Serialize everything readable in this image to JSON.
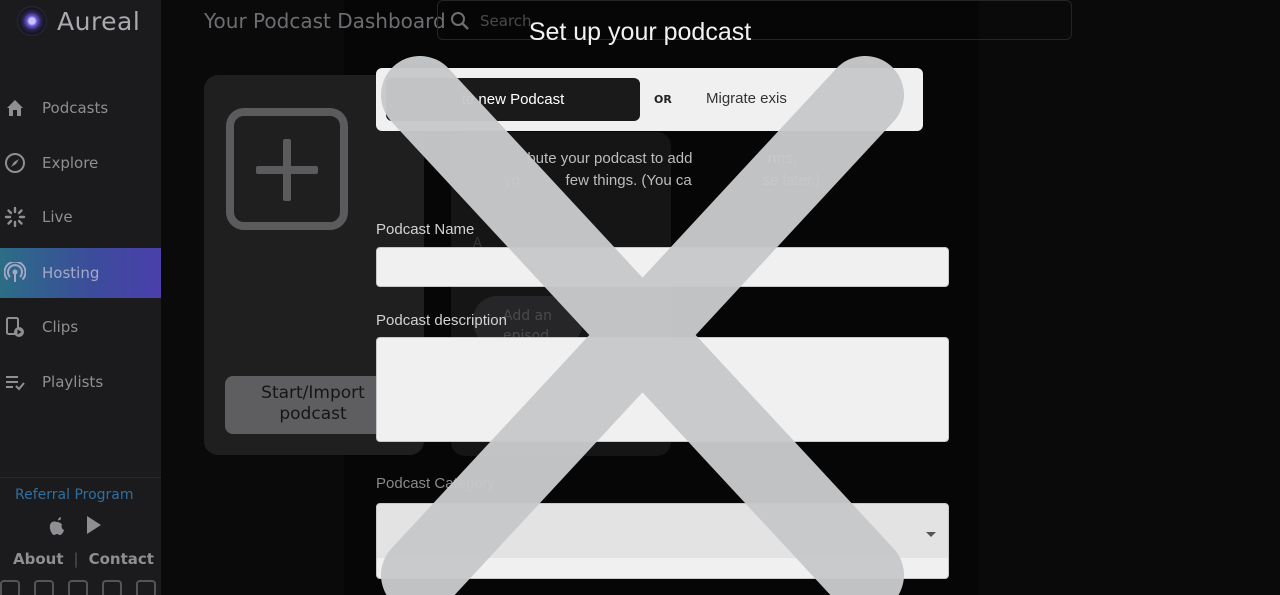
{
  "app": {
    "name": "Aureal"
  },
  "sidebar": {
    "items": [
      {
        "label": "Podcasts",
        "icon": "home-icon",
        "active": false
      },
      {
        "label": "Explore",
        "icon": "compass-icon",
        "active": false
      },
      {
        "label": "Live",
        "icon": "live-icon",
        "active": false
      },
      {
        "label": "Hosting",
        "icon": "podcast-icon",
        "active": true
      },
      {
        "label": "Clips",
        "icon": "clips-icon",
        "active": false
      },
      {
        "label": "Playlists",
        "icon": "playlist-icon",
        "active": false
      }
    ],
    "referral": "Referral Program",
    "about": "About",
    "separator": "|",
    "contact": "Contact"
  },
  "main": {
    "title": "Your Podcast Dashboard",
    "search_placeholder": "Search",
    "card": {
      "button_label_line1": "Start/Import",
      "button_label_line2": "podcast"
    },
    "card2": {
      "sub": "A",
      "add_episode": "Add an episod"
    }
  },
  "modal": {
    "title": "Set up your podcast",
    "option_new": "te new Podcast",
    "or": "OR",
    "option_migrate": "Migrate exis",
    "intro_line1": "bute your podcast to add                  rms,",
    "intro_line2": "yo           few things. (You ca                 se later.)",
    "name_label": "Podcast Name",
    "description_label": "Podcast description",
    "category_label": "Podcast Category"
  },
  "colors": {
    "accent_gradient_start": "#2c6d86",
    "accent_gradient_end": "#4a3fab",
    "overlay_x": "#c8c9cb"
  }
}
